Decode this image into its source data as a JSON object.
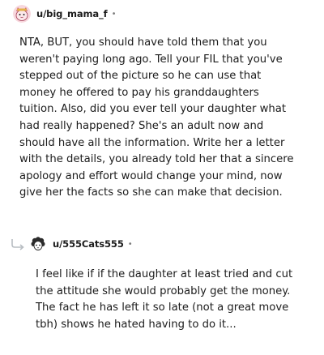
{
  "comments": [
    {
      "username": "u/big_mama_f",
      "separator": "•",
      "text": "NTA, BUT, you should have told them that you\nweren't paying long ago. Tell your FIL that you've\nstepped out of the picture so he can use that\nmoney he offered to pay his granddaughters\ntuition. Also, did you ever tell your daughter what\nhad really happened? She's an adult now and\nshould have all the information. Write her a letter\nwith the details, you already told her that a sincere\napology and effort would change your mind, now\ngive her the facts so she can make that decision.",
      "avatar_icon": "avatar-cat-icon"
    },
    {
      "username": "u/555Cats555",
      "separator": "•",
      "text": "I feel like if if the daughter at least tried and cut\nthe attitude she would probably get the money.\nThe fact he has left it so late (not a great move\ntbh) shows he hated having to do it...",
      "avatar_icon": "avatar-sheep-icon",
      "reply_icon": "reply-arrow-icon"
    }
  ],
  "colors": {
    "text": "#1c1c1c",
    "meta": "#7c7c7c",
    "reply_line": "#b8bdc2"
  }
}
